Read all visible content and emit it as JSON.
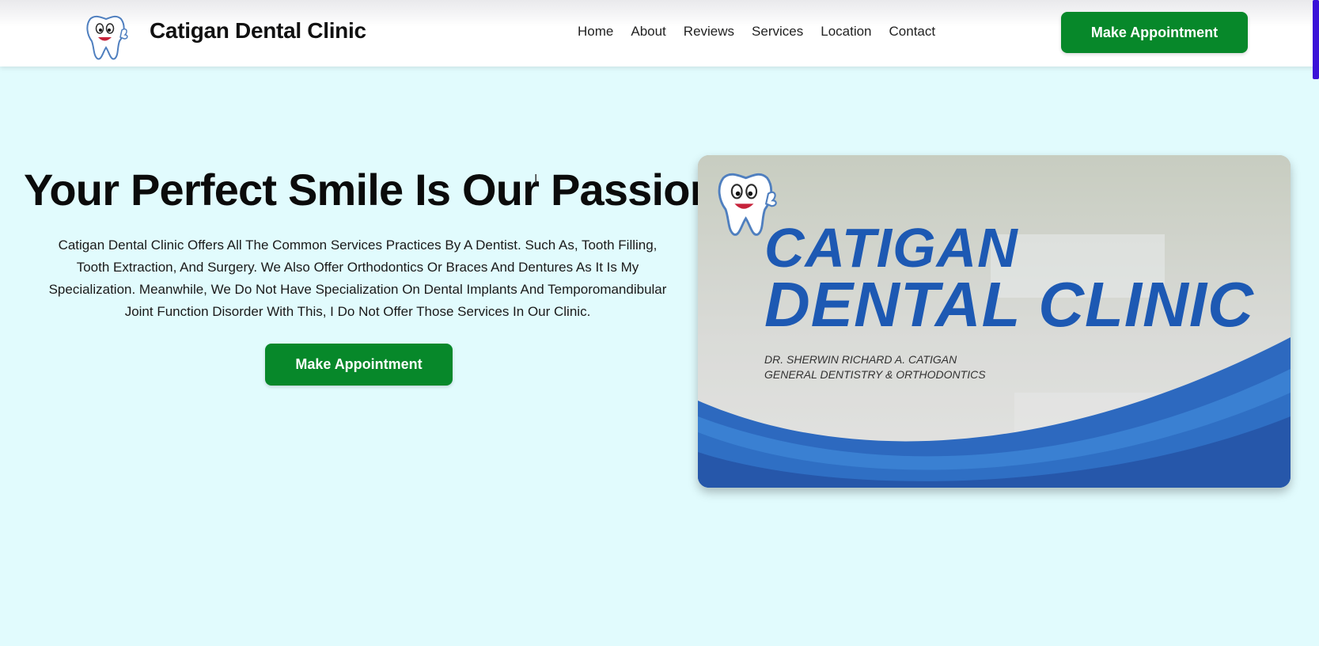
{
  "header": {
    "brand": "Catigan Dental Clinic",
    "logo_icon": "tooth-mascot-icon",
    "nav": [
      "Home",
      "About",
      "Reviews",
      "Services",
      "Location",
      "Contact"
    ],
    "cta": "Make Appointment"
  },
  "hero": {
    "title": "Your Perfect Smile Is Our Passion",
    "description": "Catigan Dental Clinic Offers All The Common Services Practices By A Dentist. Such As, Tooth Filling, Tooth Extraction, And Surgery. We Also Offer Orthodontics Or Braces And Dentures As It Is My Specialization. Meanwhile, We Do Not Have Specialization On Dental Implants And Temporomandibular Joint Function Disorder With This, I Do Not Offer Those Services In Our Clinic.",
    "cta": "Make Appointment"
  },
  "banner": {
    "title_line1": "CATIGAN",
    "title_line2": "DENTAL CLINIC",
    "doctor": "DR. SHERWIN RICHARD A. CATIGAN",
    "specialty": "GENERAL DENTISTRY & ORTHODONTICS"
  },
  "colors": {
    "background": "#e1fbfd",
    "primary_button": "#07882a",
    "banner_blue": "#1d59b3"
  }
}
